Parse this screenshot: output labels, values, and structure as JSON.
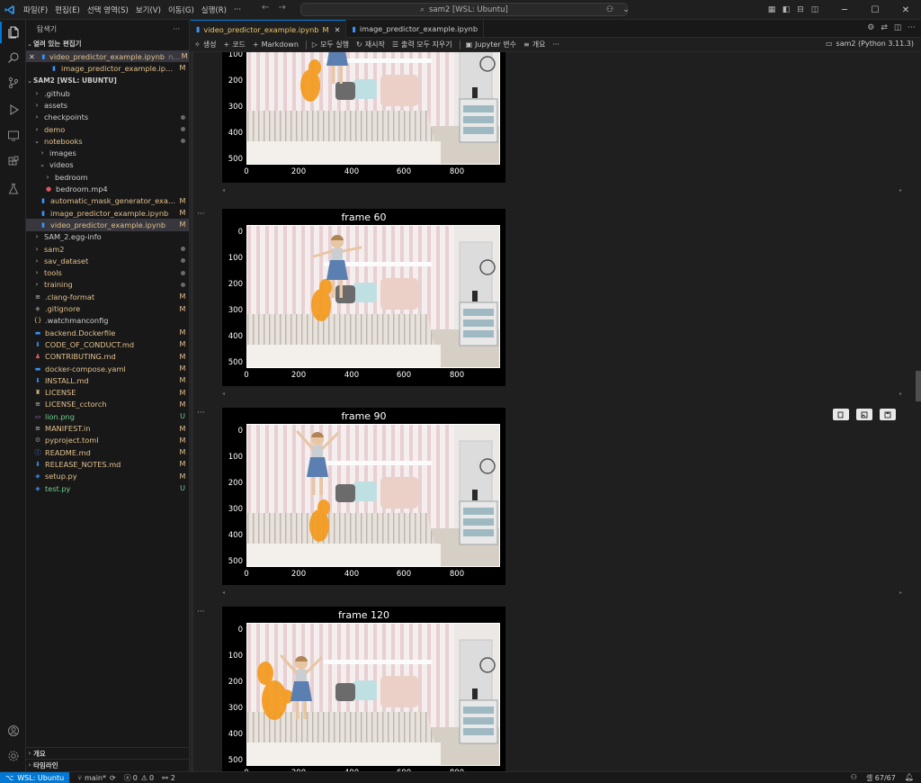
{
  "titlebar": {
    "menus": [
      "파일(F)",
      "편집(E)",
      "선택 영역(S)",
      "보기(V)",
      "이동(G)",
      "실행(R)",
      "···"
    ],
    "search": "sam2 [WSL: Ubuntu]"
  },
  "sidebar": {
    "title": "탐색기",
    "open_editors_label": "열려 있는 편집기",
    "open_editors": [
      {
        "name": "video_predictor_example.ipynb",
        "suffix": "n...",
        "badge": "M"
      },
      {
        "name": "image_predictor_example.ipynb",
        "badge": "M"
      }
    ],
    "workspace_label": "SAM2 [WSL: UBUNTU]",
    "tree": [
      {
        "name": ".github",
        "type": "folder",
        "depth": 0,
        "state": "closed",
        "badge": "",
        "color": "#cccccc"
      },
      {
        "name": "assets",
        "type": "folder",
        "depth": 0,
        "state": "closed",
        "badge": "",
        "color": "#cccccc"
      },
      {
        "name": "checkpoints",
        "type": "folder",
        "depth": 0,
        "state": "closed",
        "badge": "dot",
        "color": "#cccccc"
      },
      {
        "name": "demo",
        "type": "folder",
        "depth": 0,
        "state": "closed",
        "badge": "dot",
        "color": "#e2c08d"
      },
      {
        "name": "notebooks",
        "type": "folder",
        "depth": 0,
        "state": "open",
        "badge": "dot",
        "color": "#e2c08d"
      },
      {
        "name": "images",
        "type": "folder",
        "depth": 1,
        "state": "closed",
        "badge": "",
        "color": "#cccccc"
      },
      {
        "name": "videos",
        "type": "folder",
        "depth": 1,
        "state": "open",
        "badge": "",
        "color": "#cccccc"
      },
      {
        "name": "bedroom",
        "type": "folder",
        "depth": 2,
        "state": "closed",
        "badge": "",
        "color": "#cccccc"
      },
      {
        "name": "bedroom.mp4",
        "type": "mp4",
        "depth": 2,
        "badge": "",
        "color": "#cccccc"
      },
      {
        "name": "automatic_mask_generator_example.i...",
        "type": "ipynb",
        "depth": 1,
        "badge": "M",
        "color": "#e2c08d"
      },
      {
        "name": "image_predictor_example.ipynb",
        "type": "ipynb",
        "depth": 1,
        "badge": "M",
        "color": "#e2c08d"
      },
      {
        "name": "video_predictor_example.ipynb",
        "type": "ipynb",
        "depth": 1,
        "badge": "M",
        "color": "#e2c08d",
        "selected": true
      },
      {
        "name": "SAM_2.egg-info",
        "type": "folder",
        "depth": 0,
        "state": "closed",
        "badge": "",
        "color": "#cccccc"
      },
      {
        "name": "sam2",
        "type": "folder",
        "depth": 0,
        "state": "closed",
        "badge": "dot",
        "color": "#e2c08d"
      },
      {
        "name": "sav_dataset",
        "type": "folder",
        "depth": 0,
        "state": "closed",
        "badge": "dot",
        "color": "#e2c08d"
      },
      {
        "name": "tools",
        "type": "folder",
        "depth": 0,
        "state": "closed",
        "badge": "dot",
        "color": "#e2c08d"
      },
      {
        "name": "training",
        "type": "folder",
        "depth": 0,
        "state": "closed",
        "badge": "dot",
        "color": "#e2c08d"
      },
      {
        "name": ".clang-format",
        "type": "lines",
        "depth": 0,
        "badge": "M",
        "color": "#e2c08d"
      },
      {
        "name": ".gitignore",
        "type": "git",
        "depth": 0,
        "badge": "M",
        "color": "#e2c08d"
      },
      {
        "name": ".watchmanconfig",
        "type": "json",
        "depth": 0,
        "badge": "",
        "color": "#cccccc"
      },
      {
        "name": "backend.Dockerfile",
        "type": "docker",
        "depth": 0,
        "badge": "M",
        "color": "#e2c08d"
      },
      {
        "name": "CODE_OF_CONDUCT.md",
        "type": "md",
        "depth": 0,
        "badge": "M",
        "color": "#e2c08d"
      },
      {
        "name": "CONTRIBUTING.md",
        "type": "person",
        "depth": 0,
        "badge": "M",
        "color": "#e2c08d"
      },
      {
        "name": "docker-compose.yaml",
        "type": "docker",
        "depth": 0,
        "badge": "M",
        "color": "#e2c08d"
      },
      {
        "name": "INSTALL.md",
        "type": "md",
        "depth": 0,
        "badge": "M",
        "color": "#e2c08d"
      },
      {
        "name": "LICENSE",
        "type": "license",
        "depth": 0,
        "badge": "M",
        "color": "#e2c08d"
      },
      {
        "name": "LICENSE_cctorch",
        "type": "lines",
        "depth": 0,
        "badge": "M",
        "color": "#e2c08d"
      },
      {
        "name": "lion.png",
        "type": "png",
        "depth": 0,
        "badge": "U",
        "color": "#73c991"
      },
      {
        "name": "MANIFEST.in",
        "type": "lines",
        "depth": 0,
        "badge": "M",
        "color": "#e2c08d"
      },
      {
        "name": "pyproject.toml",
        "type": "gear",
        "depth": 0,
        "badge": "M",
        "color": "#e2c08d"
      },
      {
        "name": "README.md",
        "type": "info",
        "depth": 0,
        "badge": "M",
        "color": "#e2c08d"
      },
      {
        "name": "RELEASE_NOTES.md",
        "type": "md",
        "depth": 0,
        "badge": "M",
        "color": "#e2c08d"
      },
      {
        "name": "setup.py",
        "type": "py",
        "depth": 0,
        "badge": "M",
        "color": "#e2c08d"
      },
      {
        "name": "test.py",
        "type": "py",
        "depth": 0,
        "badge": "U",
        "color": "#73c991"
      }
    ],
    "outline_label": "개요",
    "timeline_label": "타임라인"
  },
  "tabs": [
    {
      "name": "video_predictor_example.ipynb",
      "badge": "M",
      "active": true
    },
    {
      "name": "image_predictor_example.ipynb",
      "active": false
    }
  ],
  "toolbar": {
    "generate": "생성",
    "code": "코드",
    "markdown": "Markdown",
    "run_all": "모두 실행",
    "restart": "재시작",
    "clear_outputs": "출력 모두 지우기",
    "variables": "Jupyter 변수",
    "outline": "개요",
    "more": "···",
    "kernel": "sam2 (Python 3.11.3)"
  },
  "figures": [
    {
      "title": "",
      "offset": -52
    },
    {
      "title": "frame 60",
      "offset": 174
    },
    {
      "title": "frame 90",
      "offset": 395
    },
    {
      "title": "frame 120",
      "offset": 616
    }
  ],
  "axes": {
    "yticks": [
      "0",
      "100",
      "200",
      "300",
      "400",
      "500"
    ],
    "xticks": [
      "0",
      "200",
      "400",
      "600",
      "800"
    ]
  },
  "statusbar": {
    "remote": "WSL: Ubuntu",
    "branch": "main*",
    "errors": "0",
    "warnings": "0",
    "ports": "2",
    "cells": "셀 67/67"
  },
  "colors": {
    "accent": "#0078d4",
    "modified": "#e2c08d",
    "untracked": "#73c991"
  }
}
